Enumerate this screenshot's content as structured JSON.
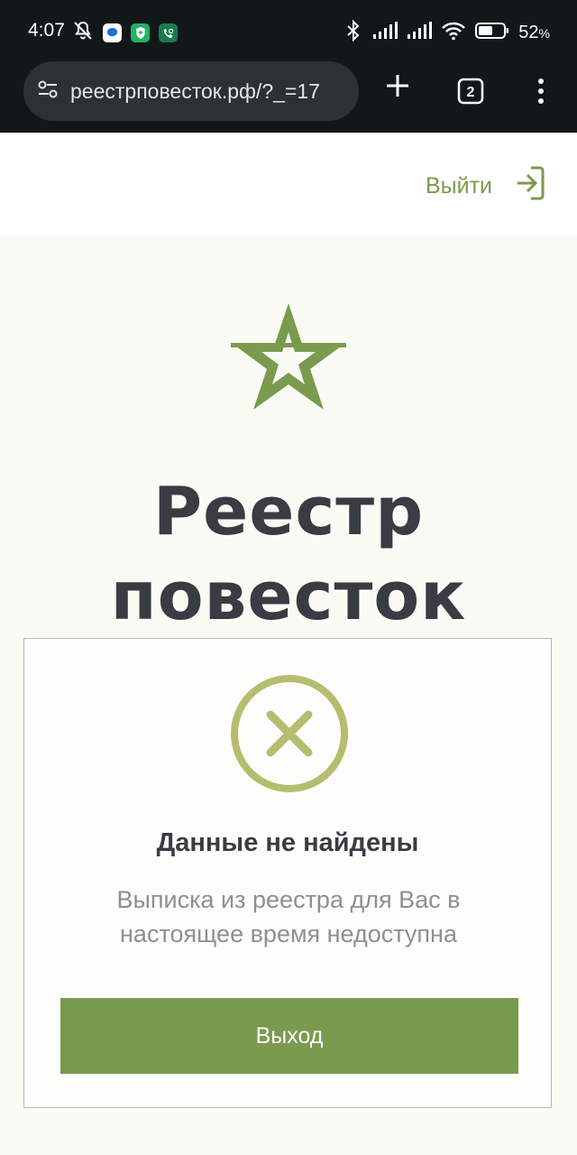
{
  "status_bar": {
    "time": "4:07",
    "battery_percent": "52",
    "battery_unit": "%",
    "icons": [
      "notifications-off-icon",
      "messenger-app-icon",
      "shield-app-icon",
      "phone-app-icon",
      "bluetooth-icon",
      "signal-icon",
      "signal-icon",
      "wifi-icon",
      "battery-icon"
    ]
  },
  "browser": {
    "url": "реестрповесток.рф/?_=17",
    "tab_count": "2",
    "icons": [
      "site-settings-icon",
      "new-tab-icon",
      "tabs-icon",
      "more-menu-icon"
    ]
  },
  "header": {
    "logout_label": "Выйти",
    "logout_icon": "login-arrow-icon",
    "accent_color": "#7a9a4e"
  },
  "hero": {
    "logo_icon": "star-icon",
    "title_line1": "Реестр",
    "title_line2": "повесток"
  },
  "card": {
    "status_icon": "close-circle-icon",
    "status_icon_color": "#b5bd6e",
    "title": "Данные не найдены",
    "message": "Выписка из реестра для Вас в настоящее время недоступна",
    "exit_button_label": "Выход",
    "button_color": "#7a9a4e"
  }
}
